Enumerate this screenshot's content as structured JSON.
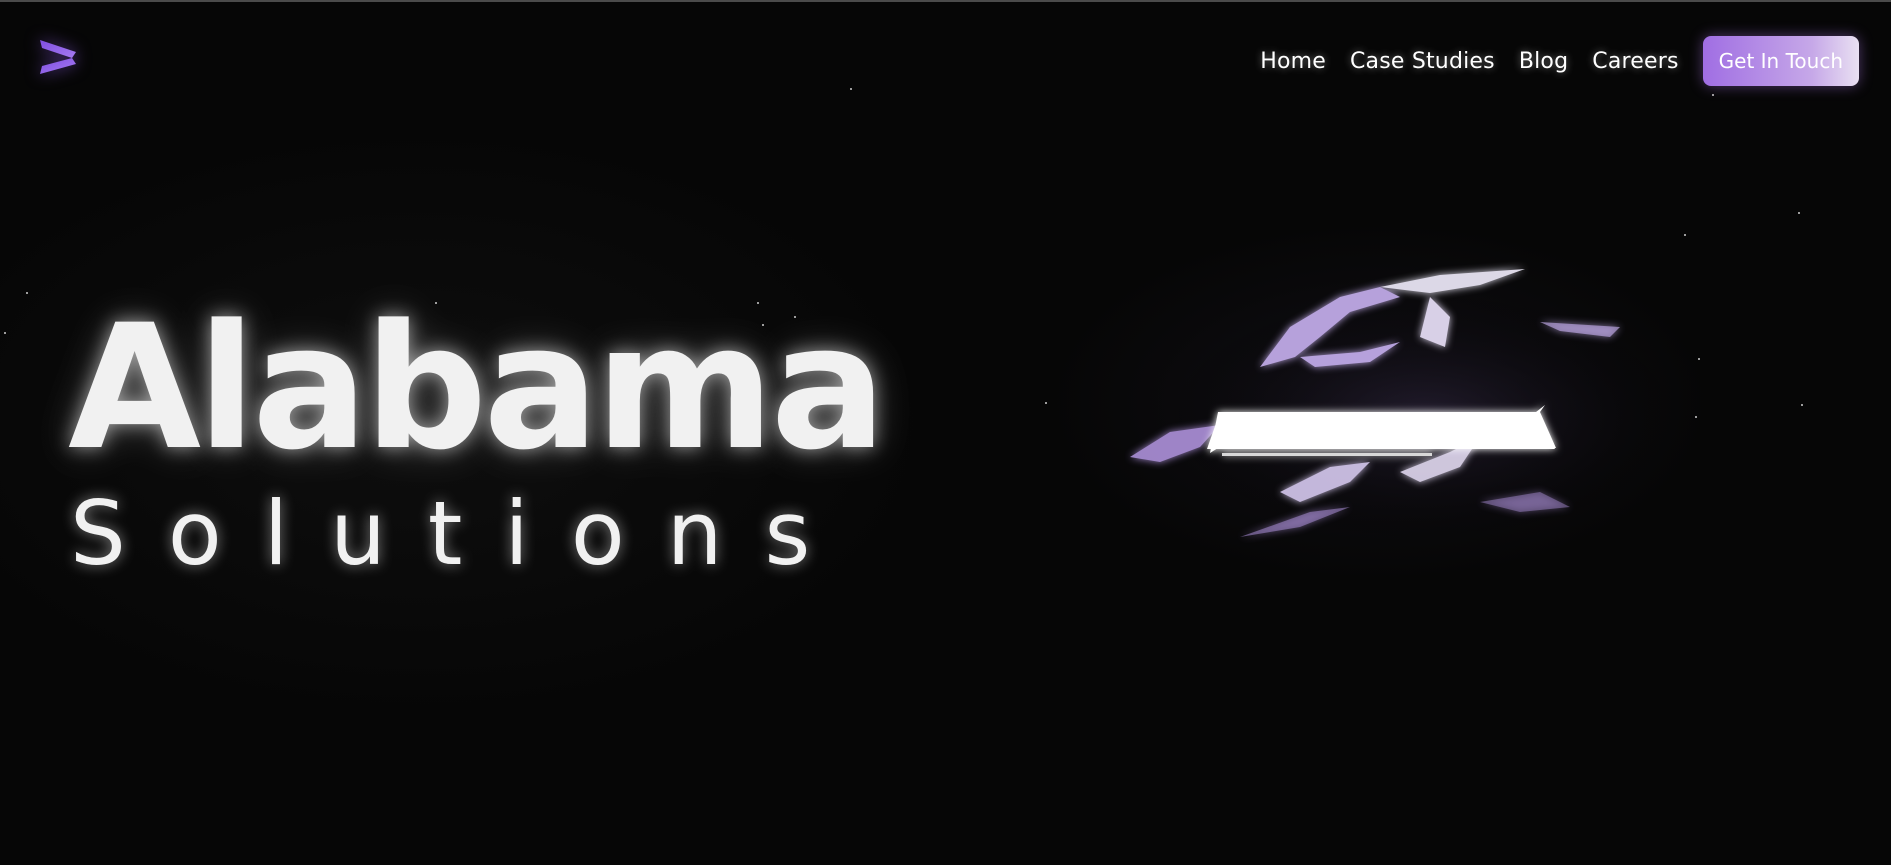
{
  "header": {
    "logo_icon": "play-chevron-logo-icon",
    "nav": [
      {
        "label": "Home"
      },
      {
        "label": "Case Studies"
      },
      {
        "label": "Blog"
      },
      {
        "label": "Careers"
      }
    ],
    "cta_label": "Get In Touch"
  },
  "hero": {
    "title": "Alabama",
    "subtitle": "Solutions",
    "artwork_icon": "glowing-3d-logo-artwork"
  },
  "colors": {
    "background": "#060606",
    "accent": "#a06ee3",
    "text": "#f1f1f1"
  }
}
